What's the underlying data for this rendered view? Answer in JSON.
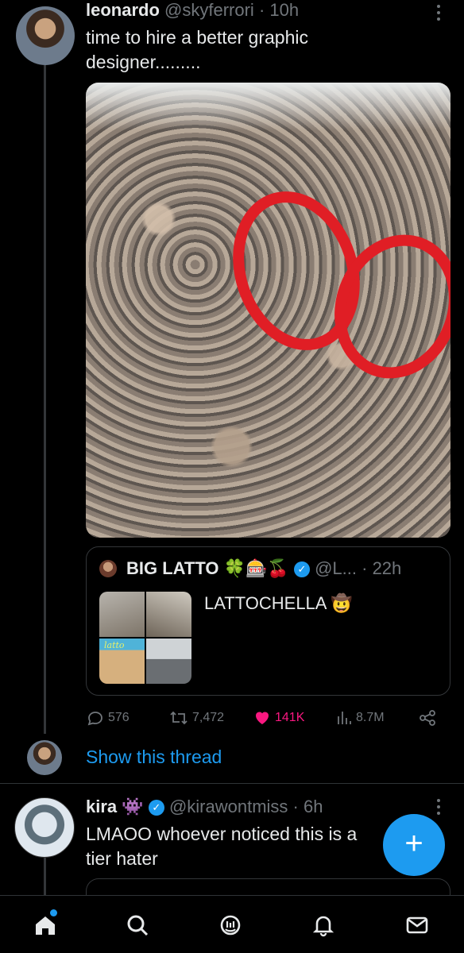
{
  "tweet1": {
    "display_name": "leonardo",
    "handle": "@skyferrori",
    "separator": "·",
    "time": "10h",
    "text_line1": "time to hire a better graphic",
    "text_line2": "designer.........",
    "more_icon": "more-vertical-icon"
  },
  "quote": {
    "display_name": "BIG LATTO",
    "emojis": "🍀🎰🍒",
    "handle": "@L...",
    "separator": "·",
    "time": "22h",
    "text": "LATTOCHELLA",
    "text_emoji": "🤠",
    "thumb_label": "latto"
  },
  "actions": {
    "replies": "576",
    "reposts": "7,472",
    "likes": "141K",
    "views": "8.7M"
  },
  "show_thread": "Show this thread",
  "tweet2": {
    "display_name": "kira",
    "emoji": "👾",
    "handle": "@kirawontmiss",
    "separator": "·",
    "time": "6h",
    "text_line1": "LMAOO whoever noticed this is a",
    "text_line2": "tier hater"
  },
  "fab": {
    "label": "+"
  },
  "colors": {
    "accent": "#1d9bf0",
    "like": "#f91880",
    "muted": "#71767b",
    "text": "#e7e9ea",
    "background": "#000000"
  },
  "nav": [
    "home-icon",
    "search-icon",
    "grok-icon",
    "notifications-icon",
    "messages-icon"
  ]
}
